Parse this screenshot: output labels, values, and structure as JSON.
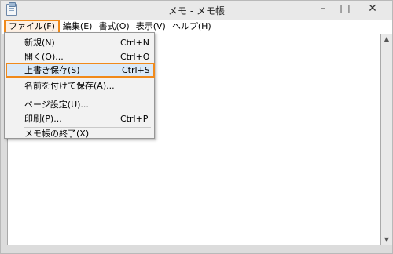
{
  "window": {
    "title": "メモ - メモ帳",
    "controls": {
      "minimize": "–",
      "maximize": "□",
      "close": "✕"
    }
  },
  "menubar": {
    "items": [
      {
        "label": "ファイル(F)"
      },
      {
        "label": "編集(E)"
      },
      {
        "label": "書式(O)"
      },
      {
        "label": "表示(V)"
      },
      {
        "label": "ヘルプ(H)"
      }
    ]
  },
  "file_menu": {
    "items": [
      {
        "label": "新規(N)",
        "shortcut": "Ctrl+N"
      },
      {
        "label": "開く(O)...",
        "shortcut": "Ctrl+O"
      },
      {
        "label": "上書き保存(S)",
        "shortcut": "Ctrl+S"
      },
      {
        "label": "名前を付けて保存(A)...",
        "shortcut": ""
      },
      {
        "label": "ページ設定(U)...",
        "shortcut": ""
      },
      {
        "label": "印刷(P)...",
        "shortcut": "Ctrl+P"
      },
      {
        "label": "メモ帳の終了(X)",
        "shortcut": ""
      }
    ]
  },
  "colors": {
    "highlight_border": "#f08a1c",
    "hover_fill": "#dbe9f7"
  },
  "icons": {
    "app": "notepad-icon",
    "scroll_up": "scroll-up-arrow-icon",
    "scroll_down": "scroll-down-arrow-icon"
  }
}
